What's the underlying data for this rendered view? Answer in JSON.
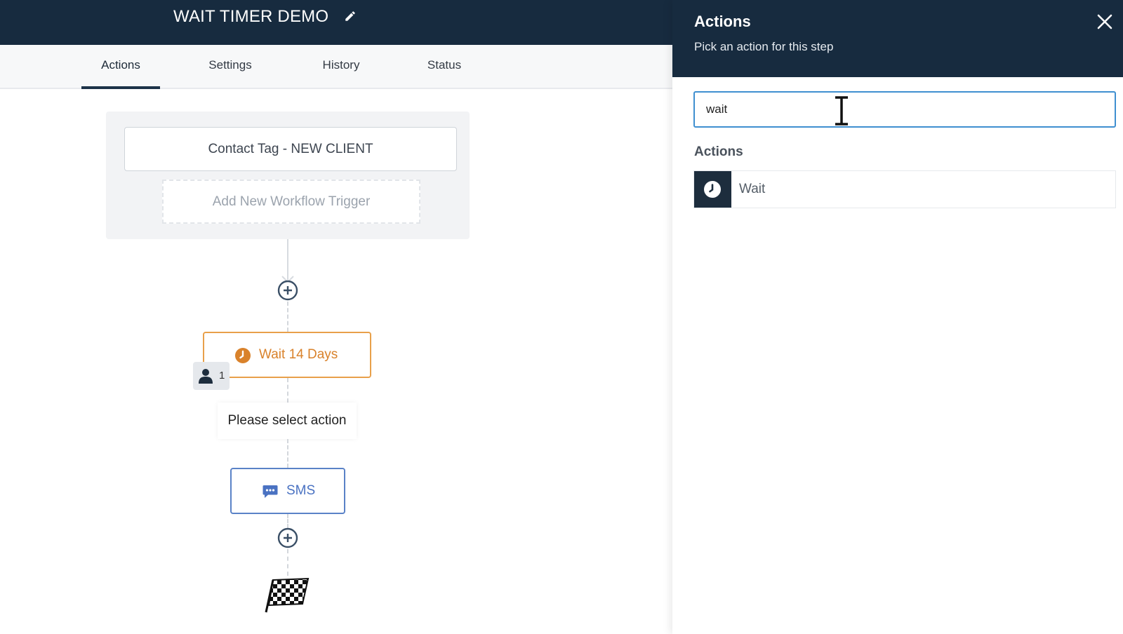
{
  "header": {
    "workflow_title": "WAIT TIMER DEMO",
    "edit_icon": "pencil-icon",
    "background_color": "#172b3f"
  },
  "tabs": [
    {
      "label": "Actions",
      "active": true
    },
    {
      "label": "Settings",
      "active": false
    },
    {
      "label": "History",
      "active": false
    },
    {
      "label": "Status",
      "active": false
    }
  ],
  "workflow": {
    "trigger": "Contact Tag - NEW CLIENT",
    "add_trigger": "Add New Workflow Trigger",
    "wait_step": {
      "label": "Wait 14 Days",
      "icon": "clock-icon",
      "color": "#d9822b",
      "contact_count": "1"
    },
    "empty_step": "Please select action",
    "sms_step": {
      "label": "SMS",
      "icon": "chat-bubble-icon",
      "color": "#4a72c2"
    },
    "end_icon": "checkered-flag-icon"
  },
  "panel": {
    "title": "Actions",
    "subtitle": "Pick an action for this step",
    "close_icon": "close-icon",
    "search": {
      "value": "wait"
    },
    "section_label": "Actions",
    "results": [
      {
        "label": "Wait",
        "icon": "clock-icon"
      }
    ]
  }
}
